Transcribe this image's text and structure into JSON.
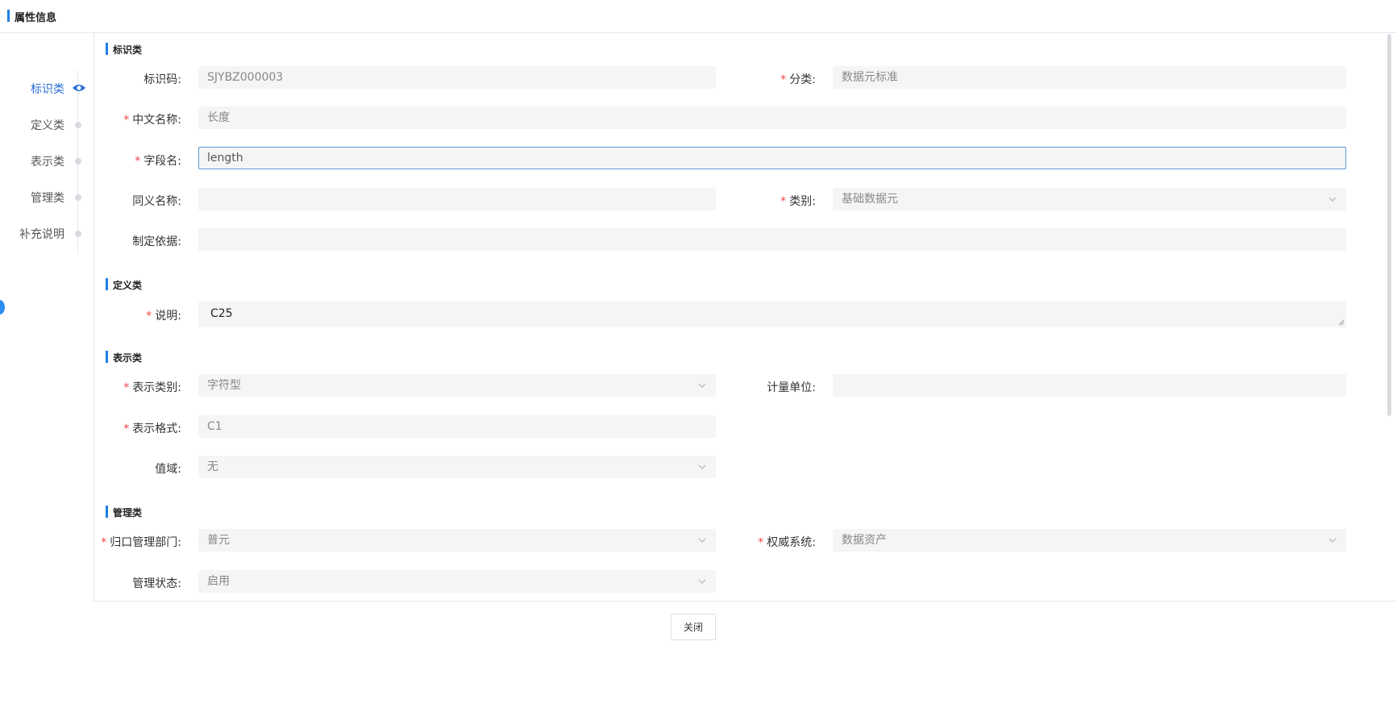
{
  "header": {
    "title": "属性信息"
  },
  "anchor_nav": {
    "items": [
      {
        "label": "标识类",
        "active": true
      },
      {
        "label": "定义类",
        "active": false
      },
      {
        "label": "表示类",
        "active": false
      },
      {
        "label": "管理类",
        "active": false
      },
      {
        "label": "补充说明",
        "active": false
      }
    ]
  },
  "sections": {
    "identification": {
      "title": "标识类",
      "code": {
        "label": "标识码:",
        "value": "SJYBZ000003"
      },
      "category": {
        "label": "分类:",
        "value": "数据元标准"
      },
      "chinese_name": {
        "label": "中文名称:",
        "value": "长度"
      },
      "field_name": {
        "label": "字段名:",
        "value": "length"
      },
      "synonym": {
        "label": "同义名称:",
        "value": ""
      },
      "type": {
        "label": "类别:",
        "value": "基础数据元"
      },
      "basis": {
        "label": "制定依据:",
        "value": ""
      }
    },
    "definition": {
      "title": "定义类",
      "description": {
        "label": "说明:",
        "value": "C25"
      }
    },
    "representation": {
      "title": "表示类",
      "repr_type": {
        "label": "表示类别:",
        "value": "字符型"
      },
      "unit": {
        "label": "计量单位:",
        "value": ""
      },
      "format": {
        "label": "表示格式:",
        "value": "C1"
      },
      "value_domain": {
        "label": "值域:",
        "value": "无"
      }
    },
    "management": {
      "title": "管理类",
      "department": {
        "label": "归口管理部门:",
        "value": "普元"
      },
      "authority_system": {
        "label": "权威系统:",
        "value": "数据资产"
      },
      "status": {
        "label": "管理状态:",
        "value": "启用"
      }
    }
  },
  "footer": {
    "close_label": "关闭"
  },
  "colors": {
    "accent": "#1e7fe8",
    "required": "#f04545",
    "active_nav": "#2b6fd6",
    "field_bg": "#f5f5f5"
  }
}
